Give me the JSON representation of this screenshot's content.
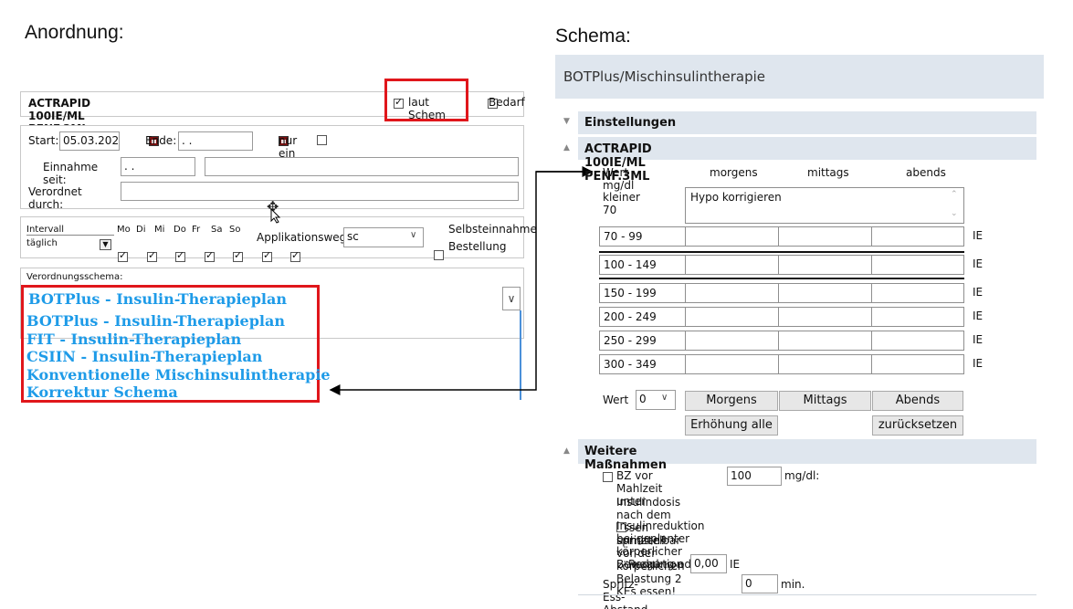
{
  "captions": {
    "left": "Anordnung:",
    "right": "Schema:"
  },
  "anordnung": {
    "drug_name": "ACTRAPID 100IE/ML PENF.3ML",
    "laut_schema": {
      "label": "laut Schem",
      "checked": true
    },
    "bedarf": {
      "label": "Bedarf",
      "checked": false
    },
    "start_label": "Start:",
    "start_value": "05.03.202",
    "ende_label": "Ende:",
    "ende_value": " .  .",
    "nur_ein_tag": {
      "label": "nur ein Tag",
      "checked": false
    },
    "einnahme_label": "Einnahme seit:",
    "einnahme_value": " .  .",
    "einnahme_extra": "",
    "verordnet_label": "Verordnet durch:",
    "verordnet_value": "",
    "intervall_label": "Intervall",
    "intervall_value": "täglich",
    "days": [
      {
        "label": "Mo",
        "checked": true
      },
      {
        "label": "Di",
        "checked": true
      },
      {
        "label": "Mi",
        "checked": true
      },
      {
        "label": "Do",
        "checked": true
      },
      {
        "label": "Fr",
        "checked": true
      },
      {
        "label": "Sa",
        "checked": true
      },
      {
        "label": "So",
        "checked": true
      }
    ],
    "applikationsweg_label": "Applikationsweg:",
    "applikationsweg_value": "sc",
    "selbsteinnahme": {
      "label": "Selbsteinnahme",
      "checked": false
    },
    "bestellung": {
      "label": "Bestellung",
      "checked": true
    },
    "verordnungsschema_label": "Verordnungsschema:",
    "verordnungsschema_value": "BOTPlus - Insulin-Therapieplan",
    "dropdown_options": [
      "BOTPlus - Insulin-Therapieplan",
      "FIT - Insulin-Therapieplan",
      "CSIIN - Insulin-Therapieplan",
      "Konventionelle Mischinsulintherapie",
      "Korrektur Schema"
    ]
  },
  "schema": {
    "title": "BOTPlus/Mischinsulintherapie",
    "einstellungen": "Einstellungen",
    "drug_section": "ACTRAPID 100IE/ML PENF.3ML",
    "columns": [
      "Wert mg/dl",
      "morgens",
      "mittags",
      "abends"
    ],
    "kleiner_label": "kleiner 70",
    "hypo_text": "Hypo korrigieren",
    "rows": [
      {
        "range": "70 - 99",
        "unit": "IE"
      },
      {
        "range": "100 - 149",
        "unit": "IE"
      },
      {
        "range": "150 - 199",
        "unit": "IE"
      },
      {
        "range": "200 - 249",
        "unit": "IE"
      },
      {
        "range": "250 - 299",
        "unit": "IE"
      },
      {
        "range": "300 - 349",
        "unit": "IE"
      }
    ],
    "wert_label": "Wert",
    "wert_value": "0",
    "buttons": {
      "morgens": "Morgens",
      "mittags": "Mittags",
      "abends": "Abends",
      "erhoehung": "Erhöhung alle",
      "zuruecksetzen": "zurücksetzen"
    },
    "weitere": "Weitere Maßnahmen",
    "bz_label": "BZ vor Mahlzeit unter",
    "bz_value": "100",
    "bz_unit": "mg/dl:",
    "insulin_text": "Insulindosis nach dem Essen spritzen!",
    "reduktion_text_1": "Insulinreduktion bei geplanter körperlicher Bewegung oder",
    "reduktion_text_2": "unmittelbar vor der körperlichen Belastung 2 KEs essen!",
    "reduktion_label": "Reduktion",
    "reduktion_value": "0,00",
    "reduktion_unit": "IE",
    "sea_label": "Spritz-Ess-Abstand (SEA)",
    "sea_value": "0",
    "sea_unit": "min."
  }
}
